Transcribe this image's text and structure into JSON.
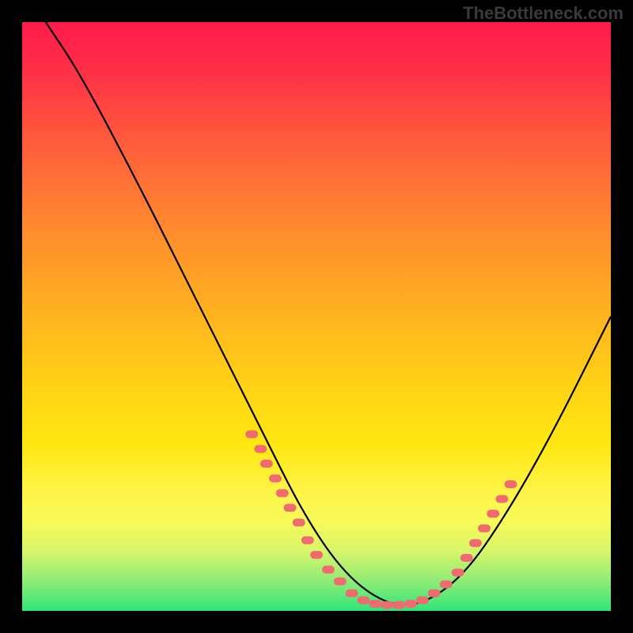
{
  "watermark": "TheBottleneck.com",
  "chart_data": {
    "type": "line",
    "title": "",
    "xlabel": "",
    "ylabel": "",
    "xlim": [
      0,
      100
    ],
    "ylim": [
      0,
      100
    ],
    "grid": false,
    "legend": false,
    "series": [
      {
        "name": "curve",
        "x": [
          4,
          10,
          20,
          30,
          40,
          48,
          55,
          62,
          68,
          75,
          82,
          90,
          100
        ],
        "y": [
          100,
          91,
          72,
          52,
          32,
          16,
          6,
          1,
          1,
          6,
          16,
          30,
          50
        ]
      }
    ],
    "markers": [
      {
        "name": "left-tick-cluster",
        "color": "#ef6b6f",
        "points": [
          {
            "x": 39.0,
            "y": 30.0
          },
          {
            "x": 40.5,
            "y": 27.5
          },
          {
            "x": 41.5,
            "y": 25.0
          },
          {
            "x": 43.0,
            "y": 22.5
          },
          {
            "x": 44.2,
            "y": 20.0
          },
          {
            "x": 45.5,
            "y": 17.5
          },
          {
            "x": 47.0,
            "y": 15.0
          },
          {
            "x": 48.5,
            "y": 12.0
          },
          {
            "x": 50.0,
            "y": 9.5
          },
          {
            "x": 52.0,
            "y": 7.0
          },
          {
            "x": 54.0,
            "y": 5.0
          }
        ]
      },
      {
        "name": "bottom-cluster",
        "color": "#ef6b6f",
        "points": [
          {
            "x": 56.0,
            "y": 3.0
          },
          {
            "x": 58.0,
            "y": 1.8
          },
          {
            "x": 60.0,
            "y": 1.2
          },
          {
            "x": 62.0,
            "y": 1.0
          },
          {
            "x": 64.0,
            "y": 1.0
          },
          {
            "x": 66.0,
            "y": 1.2
          },
          {
            "x": 68.0,
            "y": 1.8
          },
          {
            "x": 70.0,
            "y": 3.0
          },
          {
            "x": 72.0,
            "y": 4.5
          }
        ]
      },
      {
        "name": "right-tick-cluster",
        "color": "#ef6b6f",
        "points": [
          {
            "x": 74.0,
            "y": 6.5
          },
          {
            "x": 75.5,
            "y": 9.0
          },
          {
            "x": 77.0,
            "y": 11.5
          },
          {
            "x": 78.5,
            "y": 14.0
          },
          {
            "x": 80.0,
            "y": 16.5
          },
          {
            "x": 81.5,
            "y": 19.0
          },
          {
            "x": 83.0,
            "y": 21.5
          }
        ]
      }
    ],
    "background_gradient": {
      "stops": [
        {
          "pos": 0.0,
          "color": "#ff1a4a"
        },
        {
          "pos": 0.5,
          "color": "#ffb41f"
        },
        {
          "pos": 0.8,
          "color": "#fff44a"
        },
        {
          "pos": 1.0,
          "color": "#2ee57a"
        }
      ]
    }
  }
}
